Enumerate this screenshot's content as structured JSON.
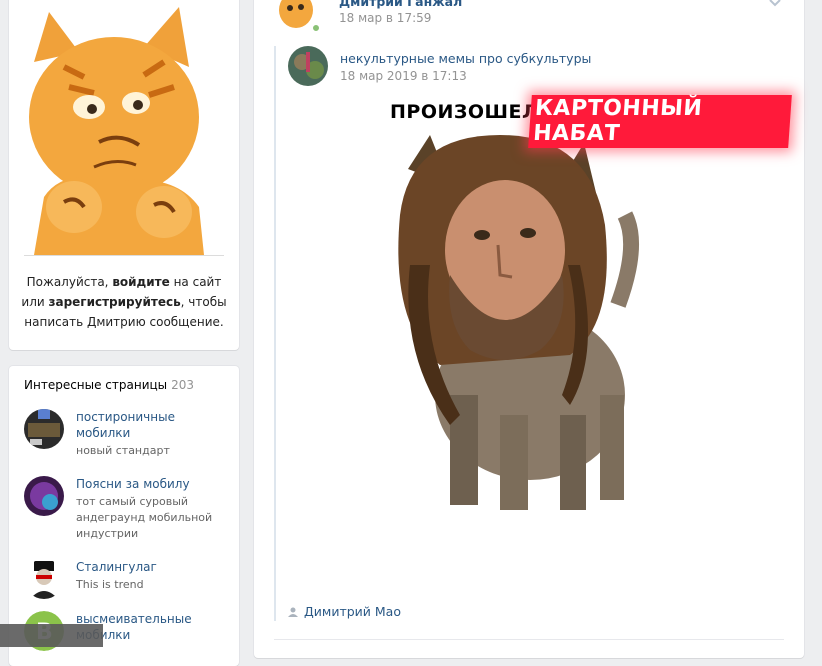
{
  "profile": {
    "login_prefix": "Пожалуйста, ",
    "login_link": "войдите",
    "login_middle": " на сайт или",
    "register_link": "зарегистрируйтесь",
    "register_suffix": ", чтобы написать Дмитрию сообщение."
  },
  "interesting_pages": {
    "title": "Интересные страницы",
    "count": "203",
    "items": [
      {
        "name": "постироничные мобилки",
        "desc": "новый стандарт"
      },
      {
        "name": "Поясни за мобилу",
        "desc": "тот самый суровый андеграунд мобильной индустрии"
      },
      {
        "name": "Сталингулаг",
        "desc": "This is trend"
      },
      {
        "name": "высмеивательные мобилки",
        "desc": ""
      }
    ]
  },
  "post": {
    "author": "Дмитрий Ганжал",
    "date": "18 мар в 17:59",
    "repost": {
      "source": "некультурные мемы про субкультуры",
      "date": "18 мар 2019 в 17:13",
      "meme_text_left": "ПРОИЗОШЕЛ",
      "meme_text_right": "КАРТОННЫЙ НАБАТ"
    },
    "signature": "Димитрий Мао"
  },
  "colors": {
    "link": "#2a5885",
    "muted": "#939393",
    "background": "#edeef0",
    "online": "#8ac176",
    "meme_banner": "#ff1a3a"
  }
}
